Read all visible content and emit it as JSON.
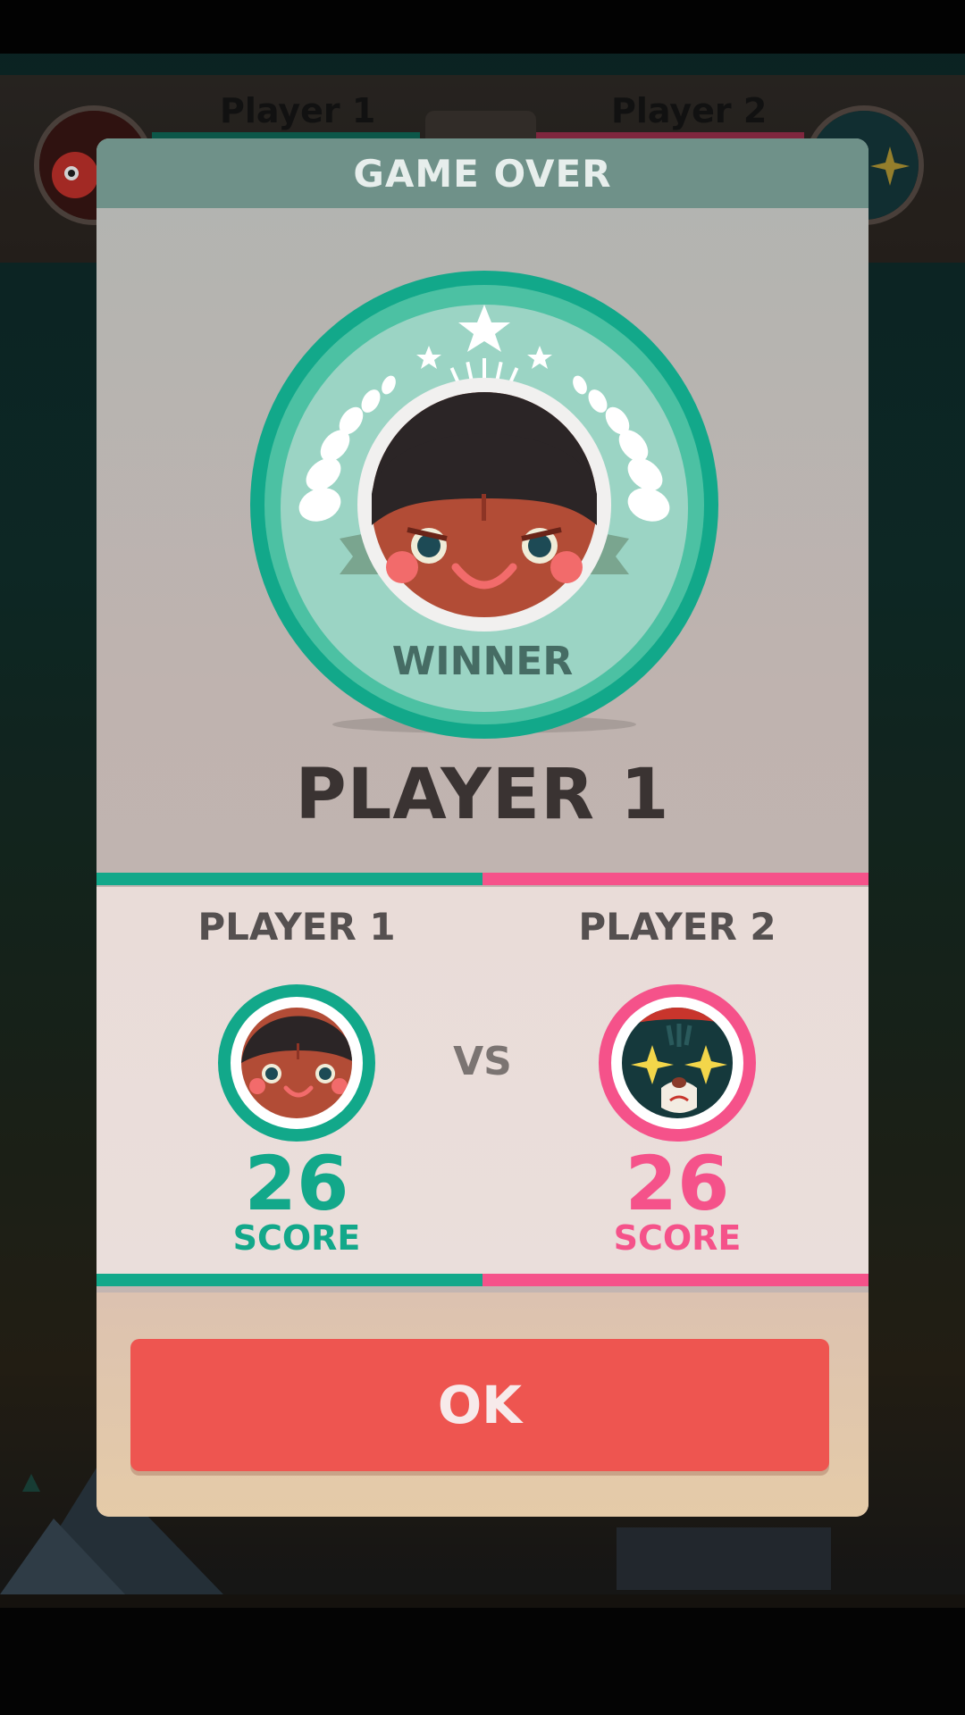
{
  "hud": {
    "player1_name": "Player 1",
    "player2_name": "Player 2"
  },
  "modal": {
    "title": "GAME OVER",
    "badge_label": "WINNER",
    "winner_name": "PLAYER 1",
    "ok_label": "OK"
  },
  "players": [
    {
      "name": "PLAYER 1",
      "score": "26",
      "score_label": "SCORE",
      "color": "#12a88a",
      "avatar_icon": "girl-face-icon"
    },
    {
      "name": "PLAYER 2",
      "score": "26",
      "score_label": "SCORE",
      "color": "#f5528a",
      "avatar_icon": "cat-face-icon"
    }
  ],
  "vs_label": "VS",
  "colors": {
    "team_green": "#12a88a",
    "team_pink": "#f5528a",
    "ok_button": "#ee5550",
    "header": "#6f9189"
  }
}
